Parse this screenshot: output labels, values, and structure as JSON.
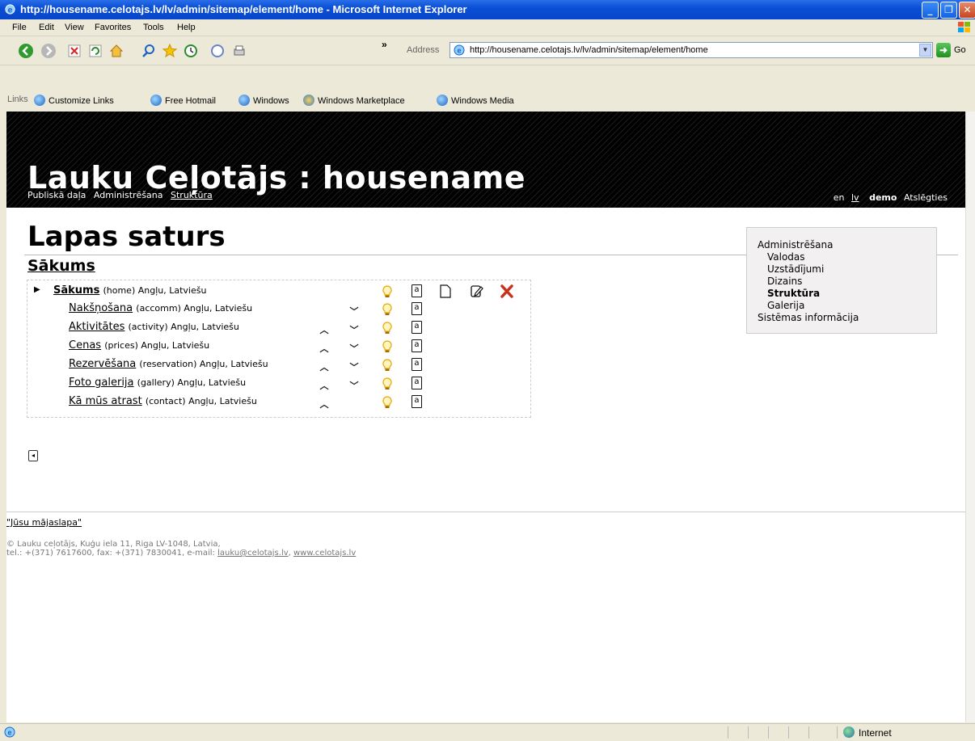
{
  "window": {
    "title": "http://housename.celotajs.lv/lv/admin/sitemap/element/home - Microsoft Internet Explorer",
    "minimize": "_",
    "maximize": "❐",
    "close": "✕"
  },
  "menu": [
    "File",
    "Edit",
    "View",
    "Favorites",
    "Tools",
    "Help"
  ],
  "toolbar": {
    "address_label": "Address",
    "address_value": "http://housename.celotajs.lv/lv/admin/sitemap/element/home",
    "go_label": "Go",
    "chevron": "»"
  },
  "links_bar": {
    "label": "Links",
    "items": [
      "Customize Links",
      "Free Hotmail",
      "Windows",
      "Windows Marketplace",
      "Windows Media"
    ]
  },
  "site": {
    "title": "Lauku Ceļotājs : housename",
    "crumbs": [
      "Publiskā daļa",
      "Administrēšana",
      "Struktūra"
    ],
    "lang_en": "en",
    "lang_lv": "lv",
    "user": "demo",
    "logout": "Atslēgties"
  },
  "page": {
    "title": "Lapas saturs",
    "subtitle": "Sākums"
  },
  "tree": [
    {
      "name": "Sākums",
      "meta": "(home) Angļu, Latviešu"
    },
    {
      "name": "Nakšņošana",
      "meta": "(accomm) Angļu, Latviešu"
    },
    {
      "name": "Aktivitātes",
      "meta": "(activity) Angļu, Latviešu"
    },
    {
      "name": "Cenas",
      "meta": "(prices) Angļu, Latviešu"
    },
    {
      "name": "Rezervēšana",
      "meta": "(reservation) Angļu, Latviešu"
    },
    {
      "name": "Foto galerija",
      "meta": "(gallery) Angļu, Latviešu"
    },
    {
      "name": "Kā mūs atrast",
      "meta": "(contact) Angļu, Latviešu"
    }
  ],
  "icons": {
    "expand": "▶",
    "up": "︿",
    "down": "﹀",
    "lang_box": "a"
  },
  "sidebar": {
    "admin": "Administrēšana",
    "items": [
      "Valodas",
      "Uzstādījumi",
      "Dizains",
      "Struktūra",
      "Galerija"
    ],
    "system": "Sistēmas informācija"
  },
  "footer": {
    "link": "\"Jūsu mājaslapa\"",
    "line1": "© Lauku ceļotājs, Kuģu iela 11, Riga LV-1048, Latvia,",
    "line2_prefix": "tel.: +(371) 7617600, fax: +(371) 7830041, e-mail: ",
    "email": "lauku@celotajs.lv",
    "sep": ", ",
    "website": "www.celotajs.lv"
  },
  "status": {
    "zone": "Internet"
  }
}
